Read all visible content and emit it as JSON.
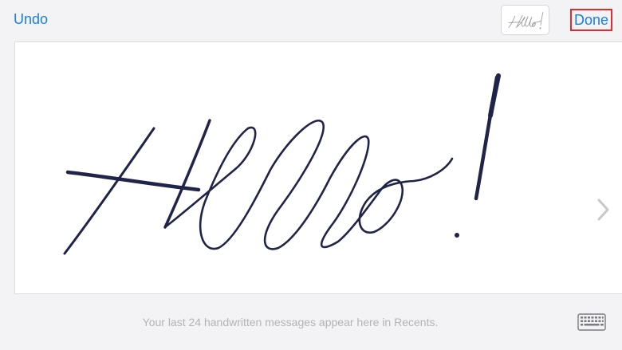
{
  "toolbar": {
    "undo_label": "Undo",
    "done_label": "Done",
    "recent_thumbnail": "Hello!"
  },
  "canvas": {
    "handwriting": "Hello!",
    "ink_color": "#1f2448",
    "next_icon": "chevron-right-icon"
  },
  "footer": {
    "hint": "Your last 24 handwritten messages appear here in Recents.",
    "keyboard_icon": "keyboard-icon"
  },
  "colors": {
    "accent": "#1a7ee0",
    "highlight": "#e22b2b",
    "background": "#f3f3f5",
    "hint_text": "#b4b4b8"
  }
}
